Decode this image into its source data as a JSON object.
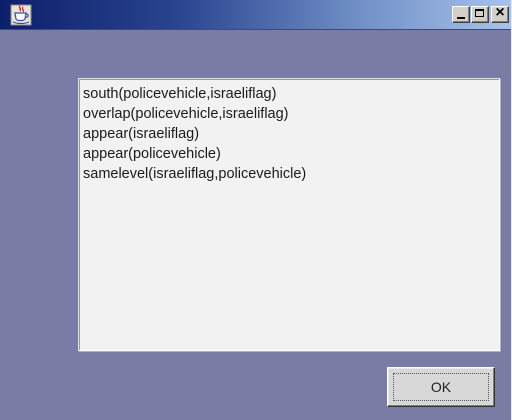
{
  "window": {
    "title": "",
    "icon": "java-cup-icon",
    "controls": {
      "minimize": "minimize-icon",
      "maximize": "maximize-icon",
      "close": "close-icon",
      "close_glyph": "×"
    }
  },
  "results": {
    "items": [
      "south(policevehicle,israeliflag)",
      "overlap(policevehicle,israeliflag)",
      "appear(israeliflag)",
      "appear(policevehicle)",
      "samelevel(israeliflag,policevehicle)"
    ]
  },
  "actions": {
    "ok_label": "OK"
  },
  "colors": {
    "background": "#7a7ca6",
    "titlebar_start": "#0c1f6a",
    "titlebar_end": "#a8c2ea",
    "list_background": "#f2f2f2",
    "button_face": "#d8d8d8"
  }
}
